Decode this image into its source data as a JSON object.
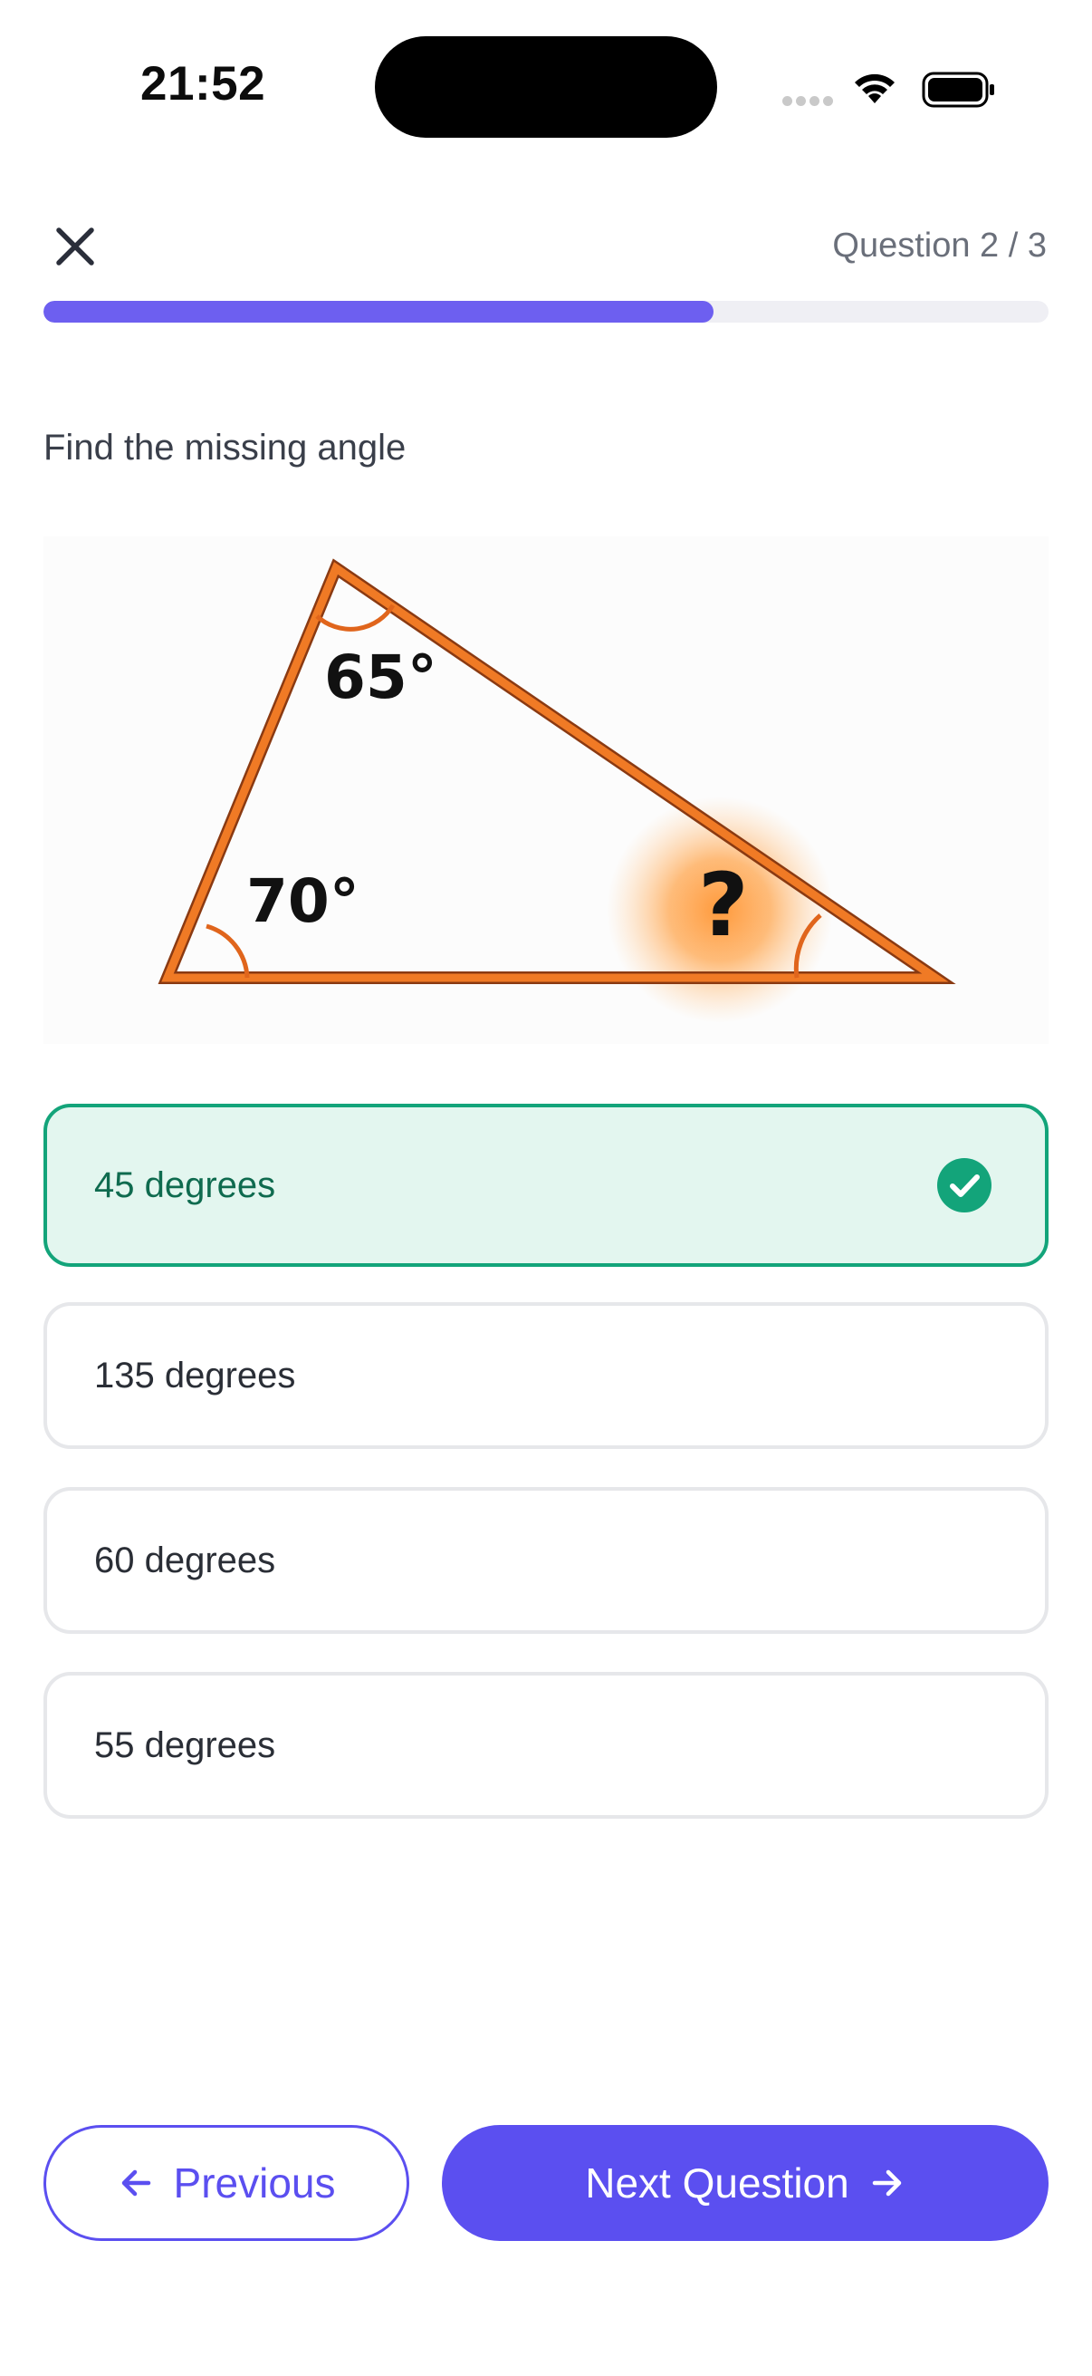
{
  "status_bar": {
    "time": "21:52"
  },
  "header": {
    "counter": "Question 2 / 3",
    "progress_fraction": 0.667
  },
  "question": {
    "prompt": "Find the missing angle",
    "figure": {
      "angle_top": "65°",
      "angle_left": "70°",
      "unknown": "?"
    }
  },
  "answers": [
    {
      "label": "45 degrees",
      "state": "correct"
    },
    {
      "label": "135 degrees",
      "state": "default"
    },
    {
      "label": "60 degrees",
      "state": "default"
    },
    {
      "label": "55 degrees",
      "state": "default"
    }
  ],
  "footer": {
    "previous_label": "Previous",
    "next_label": "Next Question"
  },
  "colors": {
    "accent": "#5b4ff0",
    "progress": "#6d5ff0",
    "correct": "#13a47a",
    "triangle": "#f07a25"
  },
  "icons": [
    "close-icon",
    "check-icon",
    "arrow-left-icon",
    "arrow-right-icon",
    "wifi-icon",
    "battery-icon"
  ]
}
